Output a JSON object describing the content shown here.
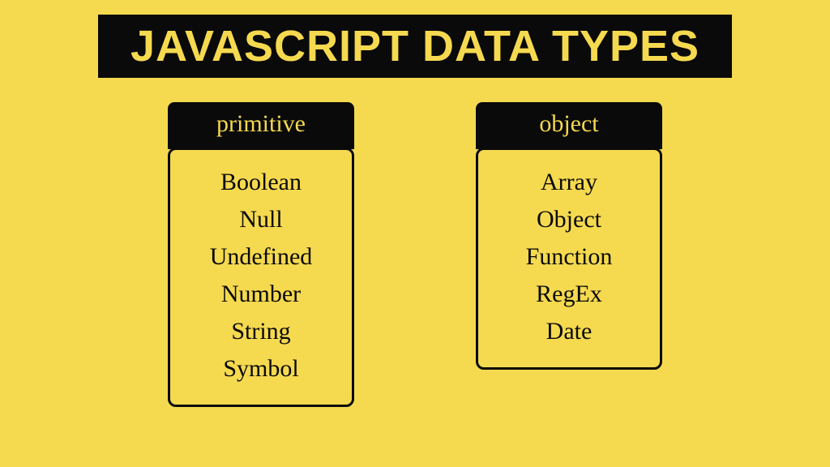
{
  "title": "JAVASCRIPT DATA TYPES",
  "columns": [
    {
      "header": "primitive",
      "items": [
        "Boolean",
        "Null",
        "Undefined",
        "Number",
        "String",
        "Symbol"
      ]
    },
    {
      "header": "object",
      "items": [
        "Array",
        "Object",
        "Function",
        "RegEx",
        "Date"
      ]
    }
  ]
}
